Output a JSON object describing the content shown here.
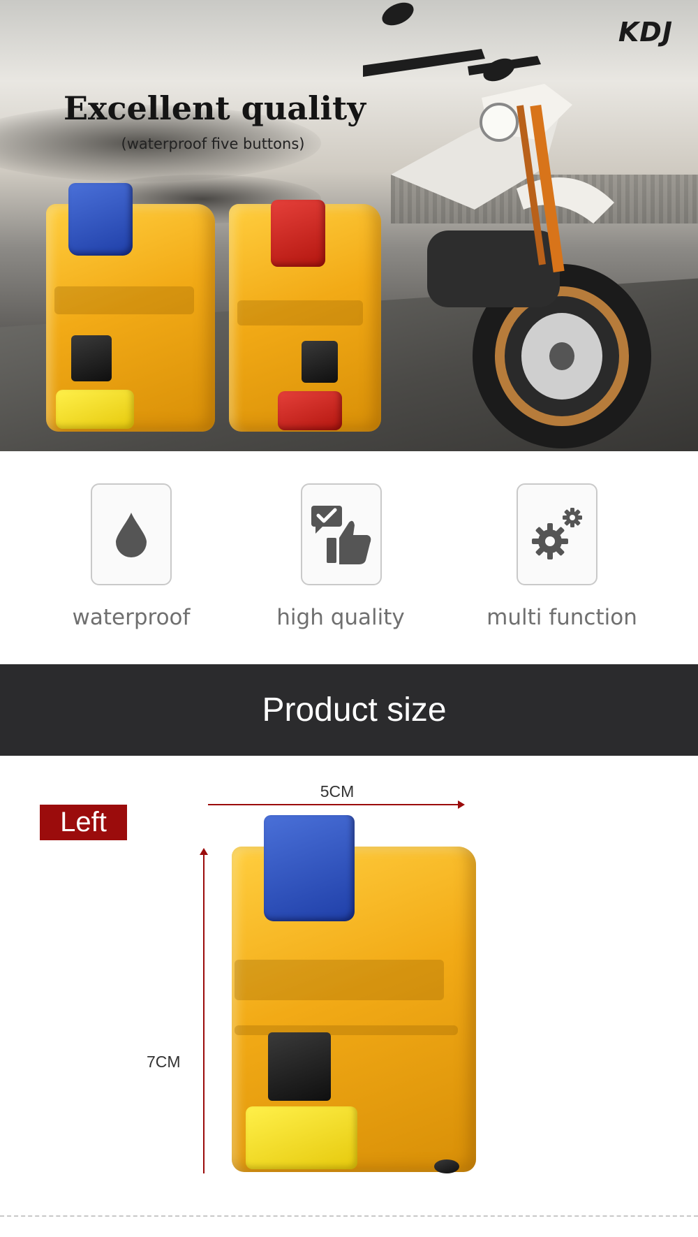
{
  "hero": {
    "brand": "KDJ",
    "title": "Excellent quality",
    "subtitle": "(waterproof five buttons)"
  },
  "features": [
    {
      "label": "waterproof",
      "icon": "water-drop-icon"
    },
    {
      "label": "high quality",
      "icon": "thumbs-up-icon"
    },
    {
      "label": "multi function",
      "icon": "gears-icon"
    }
  ],
  "size_section": {
    "title": "Product size",
    "tag": "Left",
    "width_label": "5CM",
    "height_label": "7CM"
  },
  "colors": {
    "accent": "#9b0c0c",
    "dark_bar": "#2b2b2d",
    "icon_gray": "#555555",
    "switch_amber": "#f2aa16"
  }
}
